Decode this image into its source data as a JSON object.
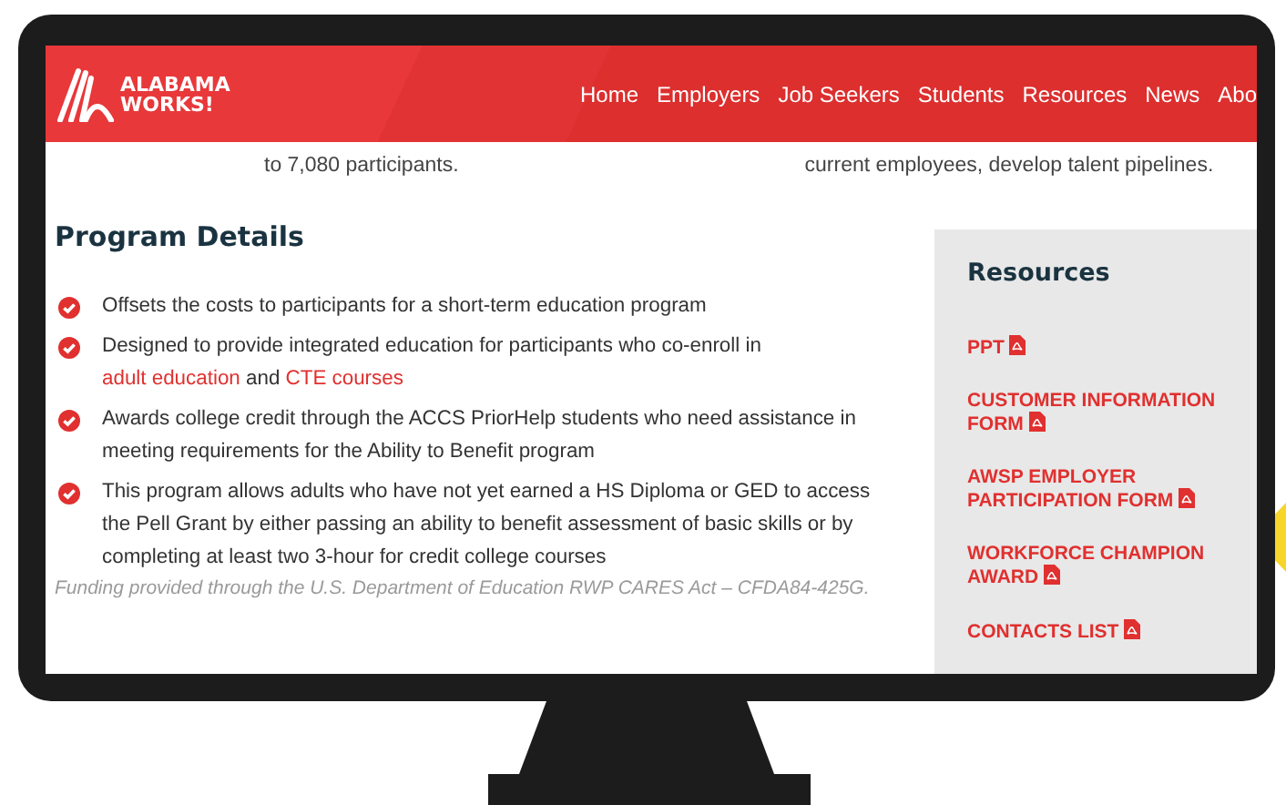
{
  "header": {
    "logo_text": [
      "ALABAMA",
      "WORKS!"
    ],
    "nav": [
      {
        "label": "Home"
      },
      {
        "label": "Employers"
      },
      {
        "label": "Job Seekers"
      },
      {
        "label": "Students"
      },
      {
        "label": "Resources"
      },
      {
        "label": "News"
      },
      {
        "label": "Abo"
      }
    ]
  },
  "intro": [
    "to 7,080 participants.",
    "current employees, develop talent pipelines."
  ],
  "program_details": {
    "heading": "Program Details",
    "items": [
      {
        "parts": [
          {
            "text": "Offsets the costs to participants for a short-term education program",
            "link": false
          }
        ]
      },
      {
        "parts": [
          {
            "text": "Designed to provide integrated education for participants who co-enroll in ",
            "link": false
          },
          {
            "text": "adult education",
            "link": true
          },
          {
            "text": " and ",
            "link": false
          },
          {
            "text": "CTE courses",
            "link": true
          }
        ]
      },
      {
        "parts": [
          {
            "text": "Awards college credit through the ACCS PriorHelp students who need assistance in meeting requirements for the Ability to Benefit program",
            "link": false
          }
        ]
      },
      {
        "parts": [
          {
            "text": "This program allows adults who have not yet earned a HS Diploma or GED to access the Pell Grant by either passing an ability to benefit assessment of basic skills or by completing at least two 3-hour for credit college courses",
            "link": false
          }
        ]
      }
    ],
    "footnote": "Funding provided through the U.S. Department of Education RWP CARES Act – CFDA84-425G."
  },
  "resources": {
    "heading": "Resources",
    "links": [
      {
        "label": "PPT"
      },
      {
        "label": "CUSTOMER INFORMATION FORM"
      },
      {
        "label": "AWSP EMPLOYER PARTICIPATION FORM"
      },
      {
        "label": "WORKFORCE CHAMPION AWARD"
      },
      {
        "label": "CONTACTS LIST"
      }
    ]
  }
}
